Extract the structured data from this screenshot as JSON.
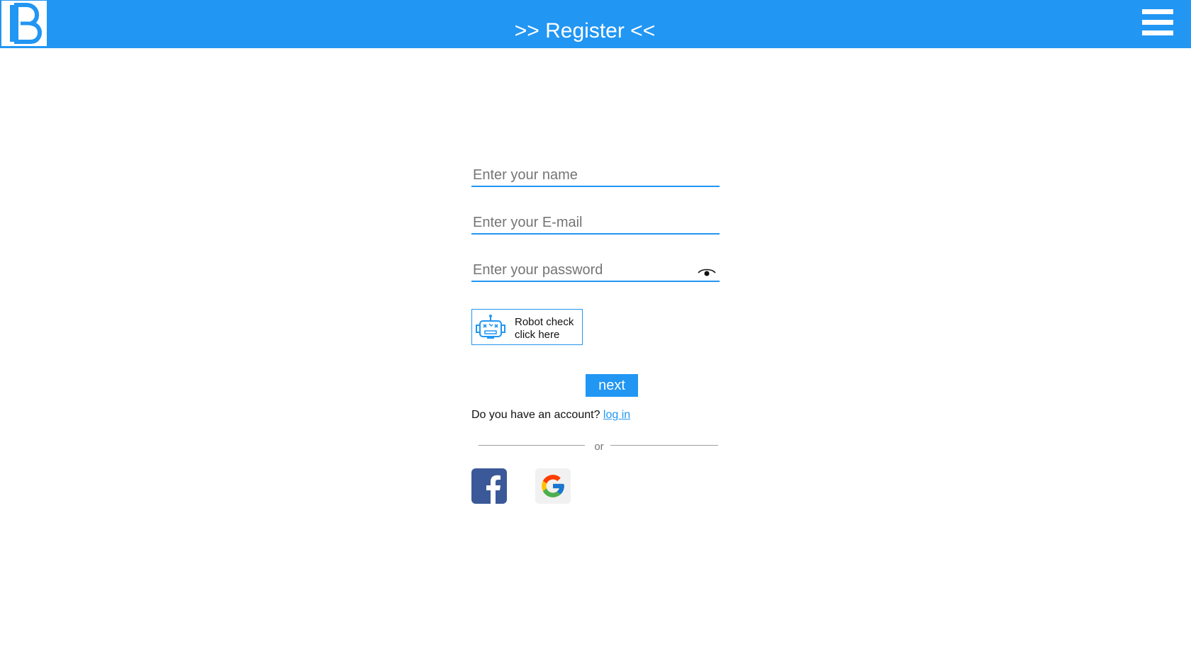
{
  "header": {
    "title": ">> Register <<",
    "logo_letter": "B",
    "background_color": "#2196f3"
  },
  "form": {
    "name_placeholder": "Enter your name",
    "email_placeholder": "Enter your E-mail",
    "password_placeholder": "Enter your password",
    "robot_check": {
      "line1": "Robot check",
      "line2": "click here"
    },
    "next_label": "next",
    "account_prompt": "Do you have an account?",
    "login_link": "log in",
    "divider_text": "or"
  },
  "social": {
    "facebook_icon": "facebook-icon",
    "google_icon": "google-icon"
  },
  "icons": {
    "menu": "hamburger-icon",
    "password_toggle": "eye-icon",
    "robot": "robot-icon"
  }
}
